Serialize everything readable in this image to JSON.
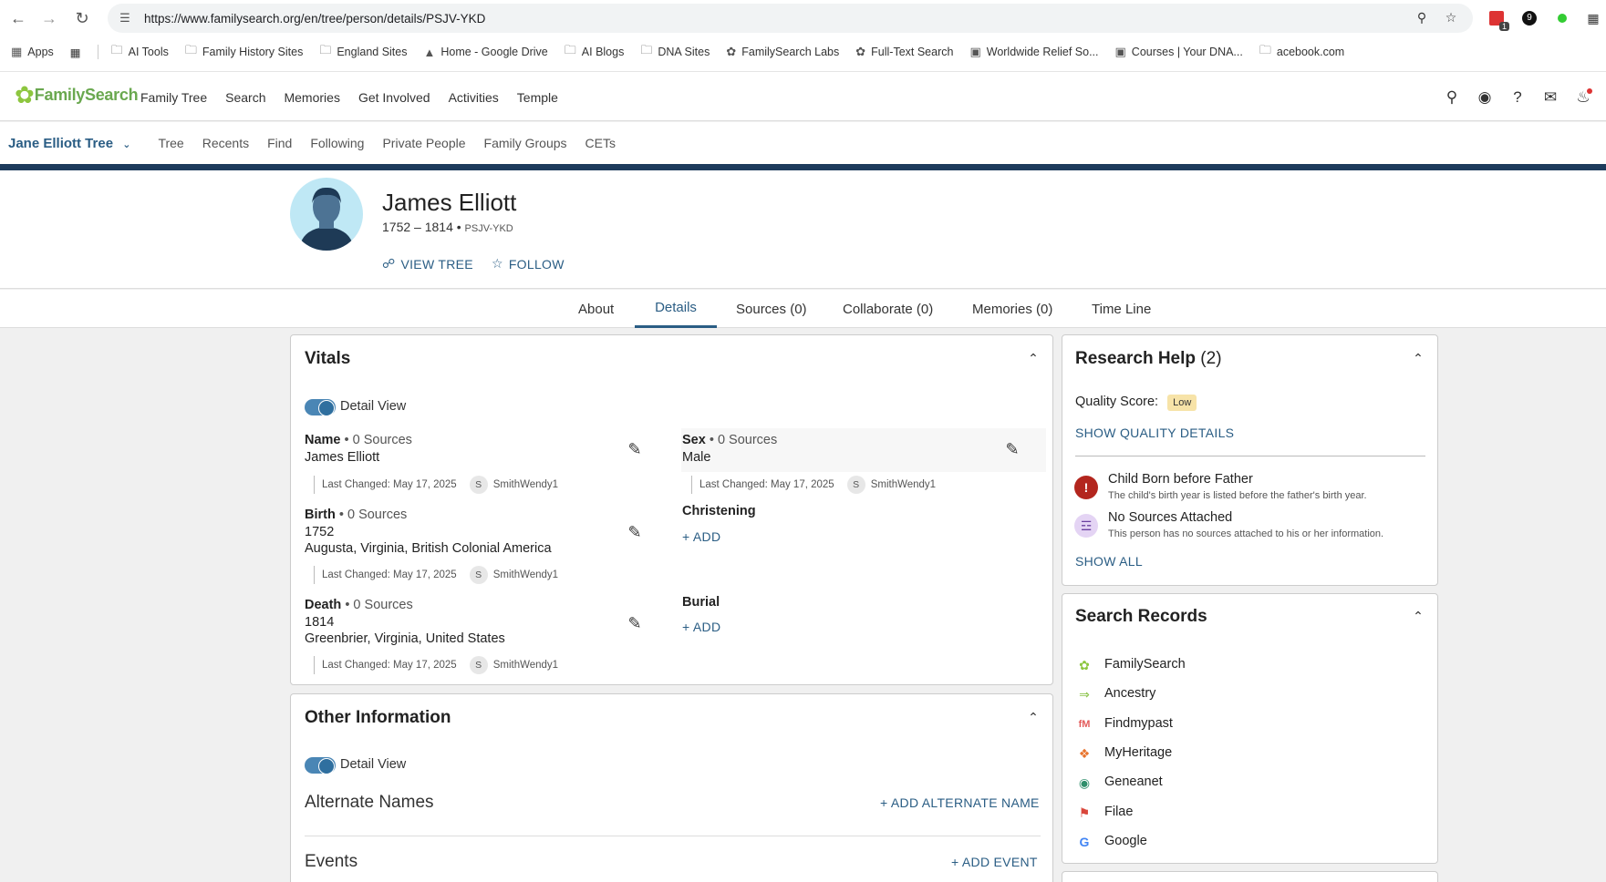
{
  "browser": {
    "url": "https://www.familysearch.org/en/tree/person/details/PSJV-YKD",
    "bookmarks": [
      {
        "label": "Apps",
        "icon": "apps-grid-icon"
      },
      {
        "label": "AI Tools",
        "icon": "folder-icon"
      },
      {
        "label": "Family History Sites",
        "icon": "folder-icon"
      },
      {
        "label": "England Sites",
        "icon": "folder-icon"
      },
      {
        "label": "Home - Google Drive",
        "icon": "google-drive-icon"
      },
      {
        "label": "AI Blogs",
        "icon": "folder-icon"
      },
      {
        "label": "DNA Sites",
        "icon": "folder-icon"
      },
      {
        "label": "FamilySearch Labs",
        "icon": "familysearch-tree-icon"
      },
      {
        "label": "Full-Text Search",
        "icon": "familysearch-tree-icon"
      },
      {
        "label": "Worldwide Relief So...",
        "icon": "site-icon"
      },
      {
        "label": "Courses | Your DNA...",
        "icon": "site-icon"
      },
      {
        "label": "acebook.com",
        "icon": "folder-icon"
      }
    ],
    "ext_badge": "1"
  },
  "header": {
    "logo_text": "FamilySearch",
    "nav": [
      "Family Tree",
      "Search",
      "Memories",
      "Get Involved",
      "Activities",
      "Temple"
    ]
  },
  "subnav": {
    "tree_name": "Jane Elliott Tree",
    "items": [
      "Tree",
      "Recents",
      "Find",
      "Following",
      "Private People",
      "Family Groups",
      "CETs"
    ]
  },
  "person": {
    "name": "James Elliott",
    "lifespan": "1752 – 1814 •",
    "pid": "PSJV-YKD",
    "view_tree": "VIEW TREE",
    "follow": "FOLLOW"
  },
  "tabs": [
    "About",
    "Details",
    "Sources (0)",
    "Collaborate (0)",
    "Memories (0)",
    "Time Line"
  ],
  "vitals": {
    "title": "Vitals",
    "detail_view": "Detail View",
    "name": {
      "label": "Name",
      "sources": " • 0 Sources",
      "value": "James Elliott",
      "changed": "Last Changed: May 17, 2025",
      "user": "SmithWendy1",
      "initial": "S"
    },
    "sex": {
      "label": "Sex",
      "sources": " • 0 Sources",
      "value": "Male",
      "changed": "Last Changed: May 17, 2025",
      "user": "SmithWendy1",
      "initial": "S"
    },
    "birth": {
      "label": "Birth",
      "sources": " • 0 Sources",
      "date": "1752",
      "place": "Augusta, Virginia, British Colonial America",
      "changed": "Last Changed: May 17, 2025",
      "user": "SmithWendy1",
      "initial": "S"
    },
    "christening": {
      "label": "Christening",
      "add": "+  ADD"
    },
    "death": {
      "label": "Death",
      "sources": " • 0 Sources",
      "date": "1814",
      "place": "Greenbrier, Virginia, United States",
      "changed": "Last Changed: May 17, 2025",
      "user": "SmithWendy1",
      "initial": "S"
    },
    "burial": {
      "label": "Burial",
      "add": "+  ADD"
    }
  },
  "other": {
    "title": "Other Information",
    "detail_view": "Detail View",
    "alt_names": "Alternate Names",
    "add_alt": "+  ADD ALTERNATE NAME",
    "events": "Events",
    "add_event": "+  ADD EVENT"
  },
  "research": {
    "title": "Research Help",
    "count": "(2)",
    "quality_label": "Quality Score:",
    "quality_value": "Low",
    "show_quality": "SHOW QUALITY DETAILS",
    "issues": [
      {
        "title": "Child Born before Father",
        "desc": "The child's birth year is listed before the father's birth year.",
        "icon": "alert-icon"
      },
      {
        "title": "No Sources Attached",
        "desc": "This person has no sources attached to his or her information.",
        "icon": "sources-icon"
      }
    ],
    "show_all": "SHOW ALL"
  },
  "search_records": {
    "title": "Search Records",
    "items": [
      "FamilySearch",
      "Ancestry",
      "Findmypast",
      "MyHeritage",
      "Geneanet",
      "Filae",
      "Google"
    ]
  },
  "colors": {
    "brand_blue": "#2a5d84",
    "nav_bar": "#1d3b5c",
    "logo_green": "#6aa84f",
    "low_badge": "#f7e3a8"
  }
}
